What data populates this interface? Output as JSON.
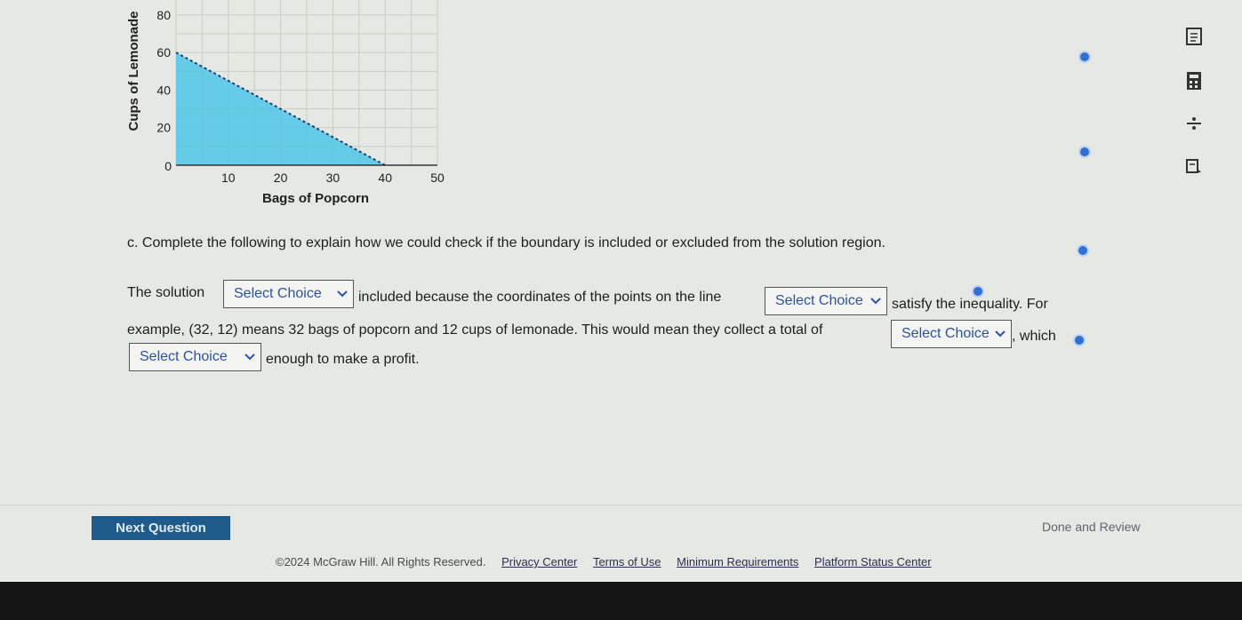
{
  "chart_data": {
    "type": "area",
    "xlabel": "Bags of Popcorn",
    "ylabel": "Cups of Lemonade",
    "xlim": [
      0,
      50
    ],
    "ylim": [
      0,
      80
    ],
    "x_ticks": [
      10,
      20,
      30,
      40,
      50
    ],
    "y_ticks": [
      20,
      40,
      60,
      80
    ],
    "origin_label": "0",
    "boundary": {
      "x": [
        0,
        40
      ],
      "y": [
        60,
        0
      ],
      "style": "dashed"
    },
    "shaded": "below boundary",
    "grid": true
  },
  "question": {
    "part_c": "c. Complete the following to explain how we could check if the boundary is included or excluded from the solution region.",
    "seg1": "The solution",
    "seg2": "included because the coordinates of the points on the line",
    "seg3": "satisfy the inequality. For",
    "seg4": "example, (32, 12) means 32 bags of popcorn and 12 cups of lemonade. This would mean they collect a total of",
    "seg5": ", which",
    "seg6": "enough to make a profit.",
    "select_placeholder": "Select Choice"
  },
  "nav": {
    "next_label": "Next Question",
    "done_label": "Done and Review"
  },
  "footer": {
    "copyright": "©2024 McGraw Hill. All Rights Reserved.",
    "links": [
      "Privacy Center",
      "Terms of Use",
      "Minimum Requirements",
      "Platform Status Center"
    ]
  },
  "colors": {
    "shade": "#4fc6e6",
    "next_button": "#1f5a8c",
    "select_text": "#2a52a6"
  },
  "icons": [
    "notes-icon",
    "calculator-icon",
    "reference-icon",
    "highlighter-icon"
  ]
}
